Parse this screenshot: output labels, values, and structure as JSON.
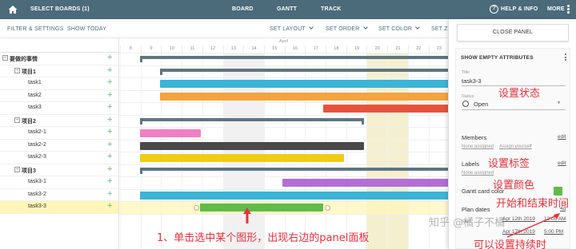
{
  "topbar": {
    "select_boards": "SELECT BOARDS (1)",
    "board": "BOARD",
    "gantt": "GANTT",
    "track": "TRACK",
    "help": "HELP & INFO",
    "help_icon_glyph": "?",
    "more": "MORE",
    "bg_color": "#4b6b7a"
  },
  "subbar": {
    "filter": "FILTER & SETTINGS",
    "show_today": "SHOW TODAY",
    "set_layout": "SET LAYOUT",
    "set_order": "SET ORDER",
    "set_color": "SET COLOR",
    "set_zoom": "SET ZO"
  },
  "tree": {
    "rows": [
      {
        "toggle": "−",
        "label": "要做的事情",
        "bold": true
      },
      {
        "toggle": "−",
        "label": "项目1",
        "bold": true
      },
      {
        "label": "task1"
      },
      {
        "label": "task2"
      },
      {
        "label": "task3"
      },
      {
        "toggle": "−",
        "label": "项目2",
        "bold": true
      },
      {
        "label": "task2-1"
      },
      {
        "label": "task2-2"
      },
      {
        "label": "task2-3"
      },
      {
        "toggle": "−",
        "label": "项目3",
        "bold": true
      },
      {
        "label": "task3-1"
      },
      {
        "label": "task3-2"
      },
      {
        "label": "task3-3",
        "selected": true
      }
    ],
    "plus_glyph": "+"
  },
  "timeline": {
    "month": "April",
    "days": [
      "8",
      "9",
      "10",
      "11",
      "12",
      "13",
      "14",
      "15",
      "16",
      "17",
      "18",
      "19",
      "20",
      "21",
      "22",
      "23"
    ],
    "weekend_days": [
      "13",
      "14",
      "20",
      "21"
    ],
    "bar_colors": {
      "summary": "#5f7580",
      "cyan": "#3bb4d6",
      "orange": "#f5a33e",
      "red": "#e6533c",
      "pink": "#f17fc4",
      "dark": "#4a4a4a",
      "yellow": "#f0cc13",
      "purple": "#b36ed6",
      "green": "#61bb4a"
    }
  },
  "annotations": {
    "click": "1、单击选中某个图形，出现右边的panel面板",
    "status": "设置状态",
    "label": "设置标签",
    "color": "设置颜色",
    "dates": "开始和结束时间",
    "extra": "可以设置持续时"
  },
  "watermark": "知乎 @橘子不橘",
  "panel": {
    "close": "CLOSE PANEL",
    "show_empty": "SHOW EMPTY ATTRIBUTES",
    "title_label": "Title",
    "title_value": "task3-3",
    "status_label": "Status",
    "status_value": "Open",
    "members_label": "Members",
    "members_edit": "edit",
    "none_assigned": "None assigned",
    "assign_yourself": "Assign yourself",
    "members_sep": "·",
    "labels_label": "Labels",
    "labels_edit": "edit",
    "labels_none": "None assigned",
    "color_label": "Gantt card color",
    "plan_label": "Plan dates",
    "plan_duration": "4d",
    "start_label": "Start:",
    "start_date": "Apr 12th 2019",
    "start_time": "12:00 AM",
    "end_date": "Apr 17th 2019",
    "end_time": "5:00 PM"
  }
}
